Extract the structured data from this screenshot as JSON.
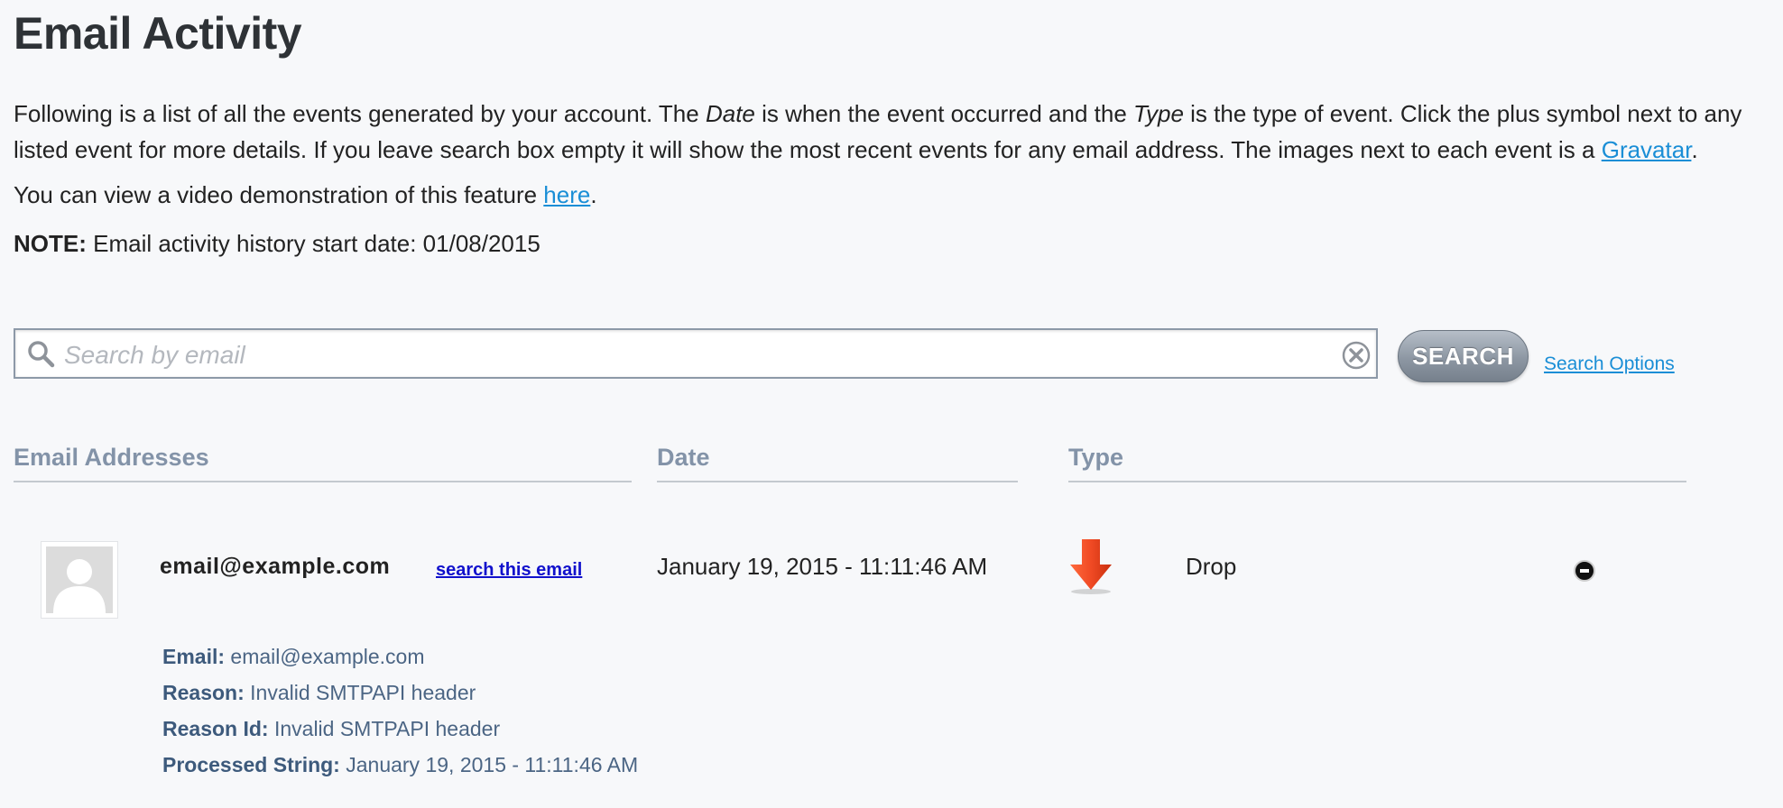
{
  "page": {
    "title": "Email Activity"
  },
  "intro": {
    "part1": "Following is a list of all the events generated by your account. The ",
    "date_word": "Date",
    "part2": " is when the event occurred and the ",
    "type_word": "Type",
    "part3": " is the type of event. Click the plus symbol next to any listed event for more details. If you leave search box empty it will show the most recent events for any email address. The images next to each event is a ",
    "gravatar_link": "Gravatar",
    "part4": ".",
    "video_text": "You can view a video demonstration of this feature ",
    "video_link": "here",
    "video_end": ".",
    "note_label": "NOTE:",
    "note_text": " Email activity history start date: 01/08/2015"
  },
  "search": {
    "placeholder": "Search by email",
    "value": "",
    "button_label": "SEARCH",
    "options_link": "Search Options",
    "icons": {
      "search": "magnifier-icon",
      "clear": "clear-x-icon"
    }
  },
  "table": {
    "headers": [
      "Email Addresses",
      "Date",
      "Type"
    ],
    "rows": [
      {
        "email": "email@example.com",
        "search_link": "search this email",
        "date": "January 19, 2015 - 11:11:46 AM",
        "type": "Drop",
        "type_icon": "red-down-arrow-icon",
        "expanded": true,
        "details": [
          {
            "label": "Email:",
            "value": " email@example.com"
          },
          {
            "label": "Reason:",
            "value": "Invalid SMTPAPI header"
          },
          {
            "label": "Reason Id:",
            "value": "Invalid SMTPAPI header"
          },
          {
            "label": "Processed String:",
            "value": "January 19, 2015 - 11:11:46 AM"
          }
        ]
      }
    ]
  },
  "colors": {
    "link": "#1a8ed6",
    "header": "#8393a8",
    "detail_text": "#4b6584",
    "drop_arrow": "#e8391e"
  }
}
